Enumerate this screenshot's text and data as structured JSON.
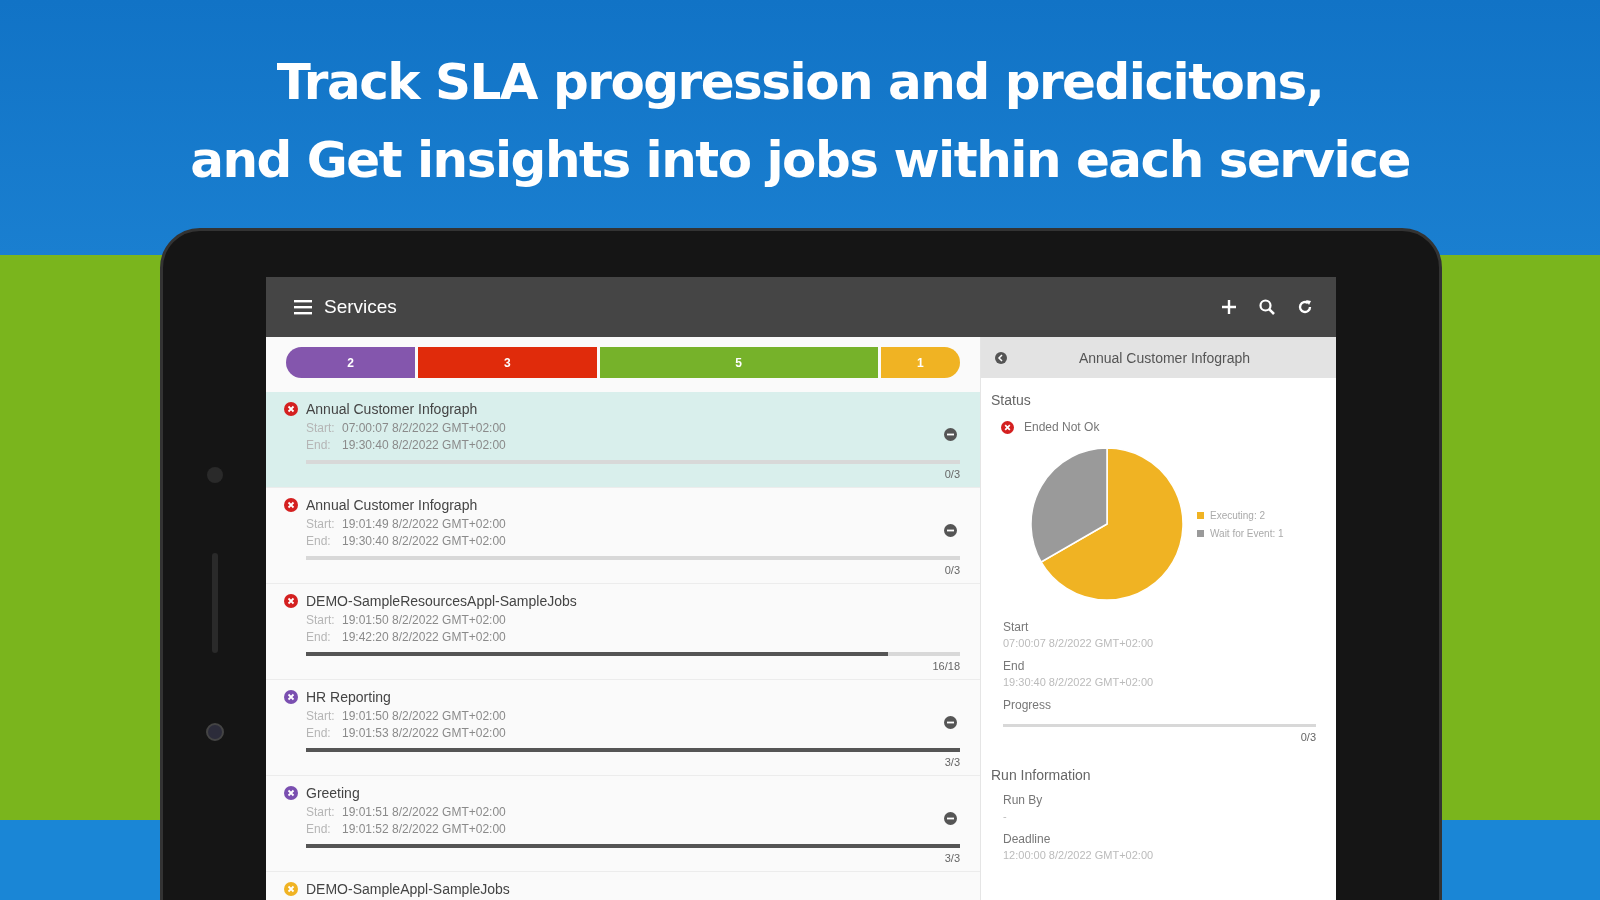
{
  "headline": [
    "Track SLA progression and predicitons,",
    "and Get insights into jobs within each service"
  ],
  "app_bar": {
    "title": "Services"
  },
  "summary": [
    {
      "count": "2",
      "color": "#8456ad"
    },
    {
      "count": "3",
      "color": "#e02b0b"
    },
    {
      "count": "5",
      "color": "#76b22a"
    },
    {
      "count": "1",
      "color": "#f0b323"
    }
  ],
  "services": [
    {
      "name": "Annual Customer Infograph",
      "color": "#d42020",
      "start_label": "Start:",
      "start": "07:00:07 8/2/2022 GMT+02:00",
      "end_label": "End:",
      "end": "19:30:40 8/2/2022 GMT+02:00",
      "level": 0,
      "progress": "0/3",
      "collapsible": true,
      "selected": true
    },
    {
      "name": "Annual Customer Infograph",
      "color": "#d42020",
      "start_label": "Start:",
      "start": "19:01:49 8/2/2022 GMT+02:00",
      "end_label": "End:",
      "end": "19:30:40 8/2/2022 GMT+02:00",
      "level": 0,
      "progress": "0/3",
      "collapsible": true,
      "selected": false
    },
    {
      "name": "DEMO-SampleResourcesAppl-SampleJobs",
      "color": "#d42020",
      "start_label": "Start:",
      "start": "19:01:50 8/2/2022 GMT+02:00",
      "end_label": "End:",
      "end": "19:42:20 8/2/2022 GMT+02:00",
      "level": 0.89,
      "progress": "16/18",
      "collapsible": false,
      "selected": false
    },
    {
      "name": "HR Reporting",
      "color": "#7a4fb0",
      "start_label": "Start:",
      "start": "19:01:50 8/2/2022 GMT+02:00",
      "end_label": "End:",
      "end": "19:01:53 8/2/2022 GMT+02:00",
      "level": 1,
      "progress": "3/3",
      "collapsible": true,
      "selected": false
    },
    {
      "name": "Greeting",
      "color": "#7a4fb0",
      "start_label": "Start:",
      "start": "19:01:51 8/2/2022 GMT+02:00",
      "end_label": "End:",
      "end": "19:01:52 8/2/2022 GMT+02:00",
      "level": 1,
      "progress": "3/3",
      "collapsible": true,
      "selected": false
    },
    {
      "name": "DEMO-SampleAppl-SampleJobs",
      "color": "#f0b323",
      "selected": false
    }
  ],
  "detail": {
    "title": "Annual Customer Infograph",
    "status_heading": "Status",
    "status": "Ended Not Ok",
    "chart_data": {
      "type": "pie",
      "categories": [
        "Executing: 2",
        "Wait for Event: 1"
      ],
      "values": [
        2,
        1
      ],
      "legend": "right",
      "colors": [
        "#f0b323",
        "#9a9a9a"
      ]
    },
    "start_label": "Start",
    "start": "07:00:07 8/2/2022 GMT+02:00",
    "end_label": "End",
    "end": "19:30:40 8/2/2022 GMT+02:00",
    "progress_label": "Progress",
    "level": 0,
    "progress": "0/3",
    "run_heading": "Run Information",
    "run_by_label": "Run By",
    "run_by": "-",
    "deadline_label": "Deadline",
    "deadline": "12:00:00 8/2/2022 GMT+02:00"
  }
}
